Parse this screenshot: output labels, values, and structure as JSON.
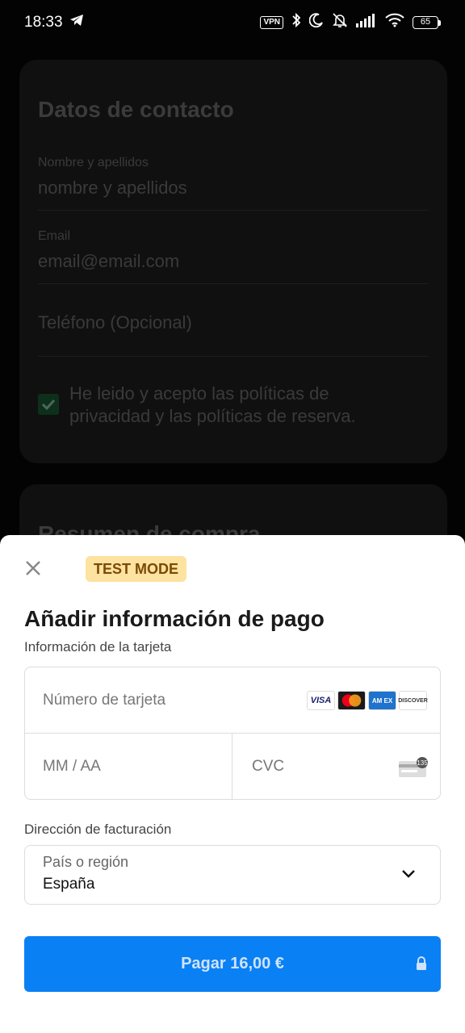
{
  "status_bar": {
    "time": "18:33",
    "vpn_label": "VPN",
    "battery": "65",
    "icons": [
      "telegram-icon",
      "bluetooth-icon",
      "moon-icon",
      "bell-off-icon",
      "signal-icon",
      "wifi-icon"
    ]
  },
  "background": {
    "contact": {
      "title": "Datos de contacto",
      "name_label": "Nombre y apellidos",
      "name_placeholder": "nombre y apellidos",
      "email_label": "Email",
      "email_placeholder": "email@email.com",
      "phone_placeholder": "Teléfono (Opcional)",
      "terms_text": "He leido y acepto las políticas de privacidad y las políticas de reserva.",
      "terms_checked": true
    },
    "summary": {
      "title": "Resumen de compra"
    }
  },
  "sheet": {
    "test_mode": "TEST MODE",
    "title": "Añadir información de pago",
    "card_section_label": "Información de la tarjeta",
    "card_number_placeholder": "Número de tarjeta",
    "expiry_placeholder": "MM / AA",
    "cvc_placeholder": "CVC",
    "cvc_icon_text": "135",
    "brands": {
      "visa": "VISA",
      "amex": "AM EX",
      "discover": "DISCOVER"
    },
    "billing_section_label": "Dirección de facturación",
    "country_label": "País o región",
    "country_value": "España",
    "pay_button": "Pagar 16,00 €"
  },
  "colors": {
    "pay_button": "#0a80f5",
    "test_badge_bg": "#fde2a0",
    "test_badge_text": "#7a4a06",
    "checkbox": "#0e2f1b"
  }
}
